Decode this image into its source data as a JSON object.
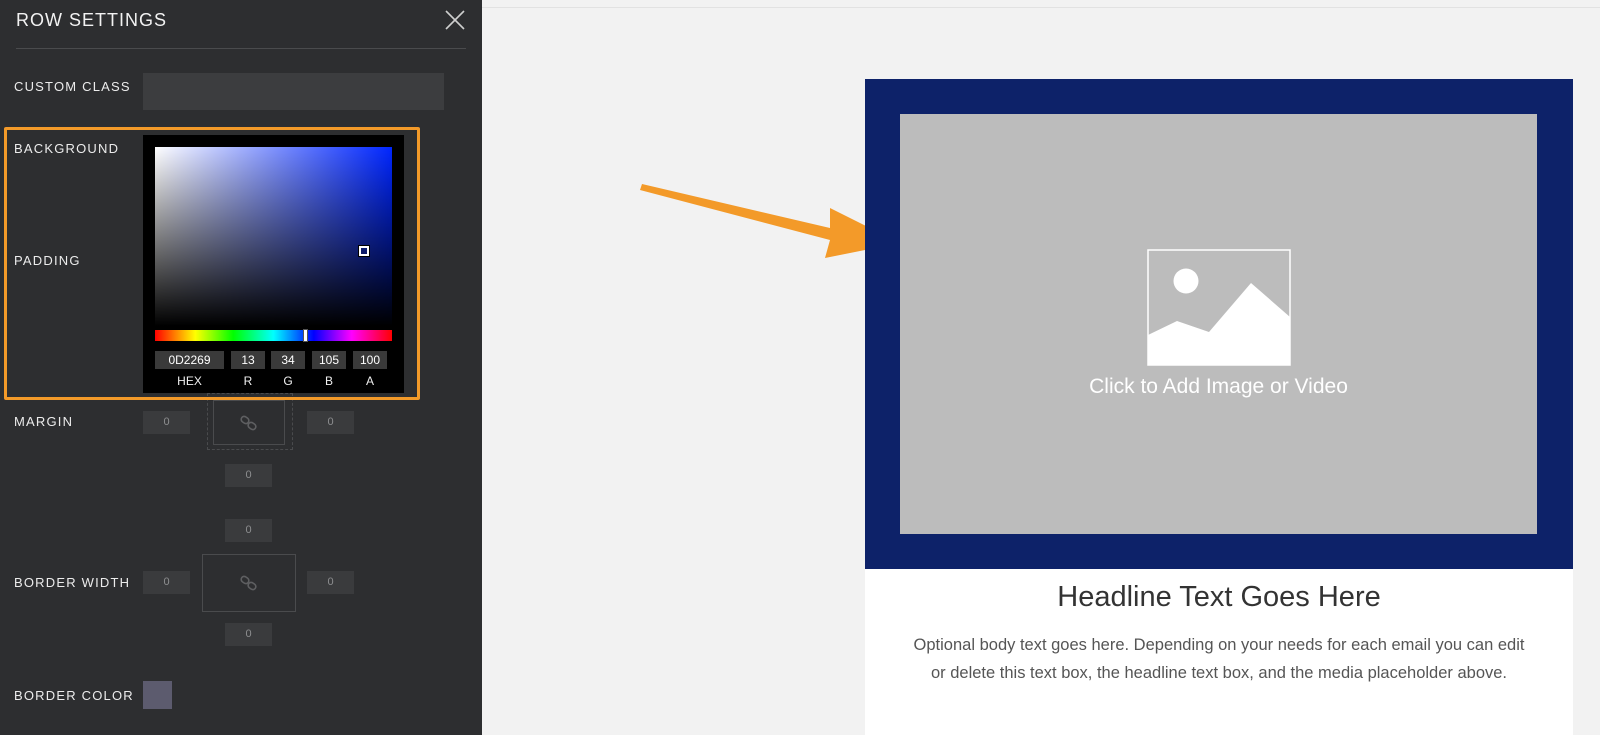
{
  "panel": {
    "title": "ROW SETTINGS",
    "labels": {
      "custom_class": "CUSTOM CLASS",
      "background": "BACKGROUND",
      "padding": "PADDING",
      "margin": "MARGIN",
      "border_width": "BORDER WIDTH",
      "border_color": "BORDER COLOR"
    },
    "custom_class_value": "",
    "color_picker": {
      "hex": "0D2269",
      "r": "13",
      "g": "34",
      "b": "105",
      "a": "100",
      "captions": {
        "hex": "HEX",
        "r": "R",
        "g": "G",
        "b": "B",
        "a": "A"
      }
    },
    "margin": {
      "left": "0",
      "right": "0",
      "bottom": "0"
    },
    "border_width": {
      "top": "0",
      "left": "0",
      "right": "0",
      "bottom": "0"
    },
    "border_color": "#5c5b6e",
    "icons": {
      "close": "close-icon",
      "link": "link-icon"
    }
  },
  "canvas": {
    "row_background": "#0d2269",
    "media_label": "Click to Add Image or Video",
    "headline": "Headline Text Goes Here",
    "body": "Optional body text goes here. Depending on your needs for each email you can edit or delete this text box, the headline text box, and the media placeholder above.",
    "annotation_color": "#f39a29"
  }
}
